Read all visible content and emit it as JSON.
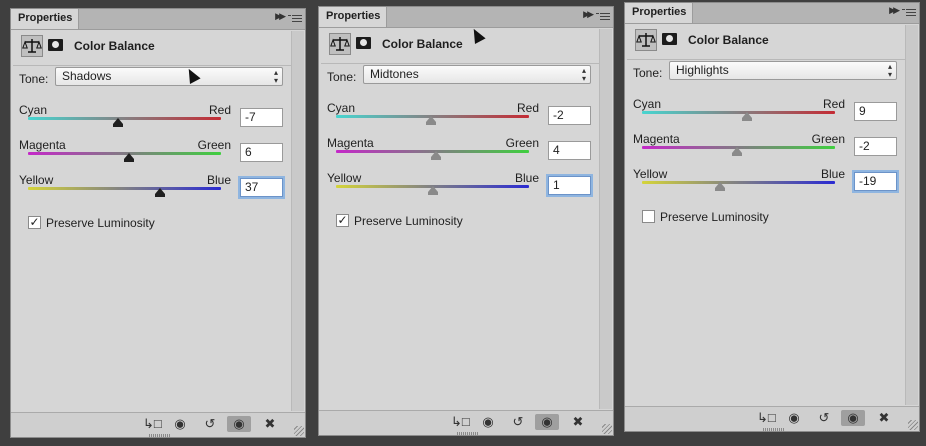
{
  "panels": [
    {
      "tab": "Properties",
      "title": "Color Balance",
      "tone_label": "Tone:",
      "tone": "Shadows",
      "sliders": [
        {
          "left": "Cyan",
          "right": "Red",
          "value": "-7",
          "level": 0.465
        },
        {
          "left": "Magenta",
          "right": "Green",
          "value": "6",
          "level": 0.525
        },
        {
          "left": "Yellow",
          "right": "Blue",
          "value": "37",
          "level": 0.685
        }
      ],
      "preserve_label": "Preserve Luminosity",
      "preserve_checked": true
    },
    {
      "tab": "Properties",
      "title": "Color Balance",
      "tone_label": "Tone:",
      "tone": "Midtones",
      "sliders": [
        {
          "left": "Cyan",
          "right": "Red",
          "value": "-2",
          "level": 0.49
        },
        {
          "left": "Magenta",
          "right": "Green",
          "value": "4",
          "level": 0.52
        },
        {
          "left": "Yellow",
          "right": "Blue",
          "value": "1",
          "level": 0.505
        }
      ],
      "preserve_label": "Preserve Luminosity",
      "preserve_checked": true
    },
    {
      "tab": "Properties",
      "title": "Color Balance",
      "tone_label": "Tone:",
      "tone": "Highlights",
      "sliders": [
        {
          "left": "Cyan",
          "right": "Red",
          "value": "9",
          "level": 0.545
        },
        {
          "left": "Magenta",
          "right": "Green",
          "value": "-2",
          "level": 0.49
        },
        {
          "left": "Yellow",
          "right": "Blue",
          "value": "-19",
          "level": 0.405
        }
      ],
      "preserve_label": "Preserve Luminosity",
      "preserve_checked": false
    }
  ],
  "track_gradients": [
    [
      "#47d5d0",
      "#c42b34"
    ],
    [
      "#c428c8",
      "#3fcf3f"
    ],
    [
      "#d4d43a",
      "#2a2ad2"
    ]
  ],
  "icons": {
    "collapse": "double-chevron-right-icon",
    "menu": "panel-menu-icon",
    "adjustment": "balance-scale-icon",
    "mask": "layer-mask-icon",
    "footer": [
      "clip-to-layer-icon",
      "view-previous-state-icon",
      "reset-icon",
      "visibility-eye-icon",
      "trash-icon"
    ]
  },
  "focused_fields": [
    {
      "panel": 0,
      "slider": 2
    },
    {
      "panel": 1,
      "slider": 2
    },
    {
      "panel": 2,
      "slider": 2
    }
  ]
}
